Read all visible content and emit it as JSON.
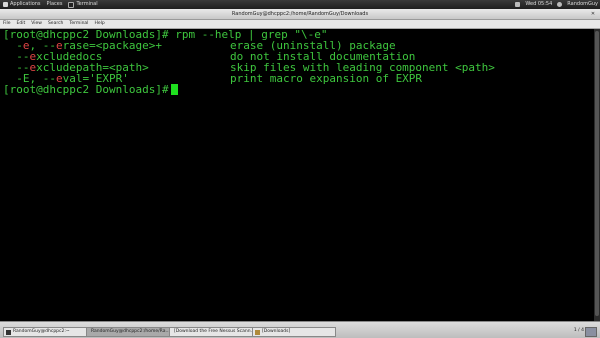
{
  "top_panel": {
    "applications": "Applications",
    "places": "Places",
    "app": "Terminal",
    "clock": "Wed 05:54",
    "user": "RandomGuy"
  },
  "window": {
    "title": "RandomGuy@dhcppc2:/home/RandomGuy/Downloads"
  },
  "menu": [
    "File",
    "Edit",
    "View",
    "Search",
    "Terminal",
    "Help"
  ],
  "terminal": {
    "prompt": "[root@dhcppc2 Downloads]#",
    "command": " rpm --help | grep \"\\-e\"",
    "options": [
      {
        "pre": "  -",
        "hl": "e",
        "post": ", --",
        "hl2": "e",
        "rest": "rase=<package>+",
        "desc": "erase (uninstall) package"
      },
      {
        "pre": "  --",
        "hl": "e",
        "post": "xcludedocs",
        "hl2": "",
        "rest": "",
        "desc": "do not install documentation"
      },
      {
        "pre": "  --",
        "hl": "e",
        "post": "xcludepath=<path>",
        "hl2": "",
        "rest": "",
        "desc": "skip files with leading component <path>"
      },
      {
        "pre": "  -E, --",
        "hl": "e",
        "post": "val='EXPR'",
        "hl2": "",
        "rest": "",
        "desc": "print macro expansion of EXPR"
      }
    ],
    "prompt2": "[root@dhcppc2 Downloads]#"
  },
  "taskbar": {
    "tasks": [
      "RandomGuy@dhcppc2:~",
      "RandomGuy@dhcppc2:/home/Ra...",
      "[Download the Free Nessus Scann...",
      "[Downloads]"
    ],
    "pager": "1 / 4"
  }
}
